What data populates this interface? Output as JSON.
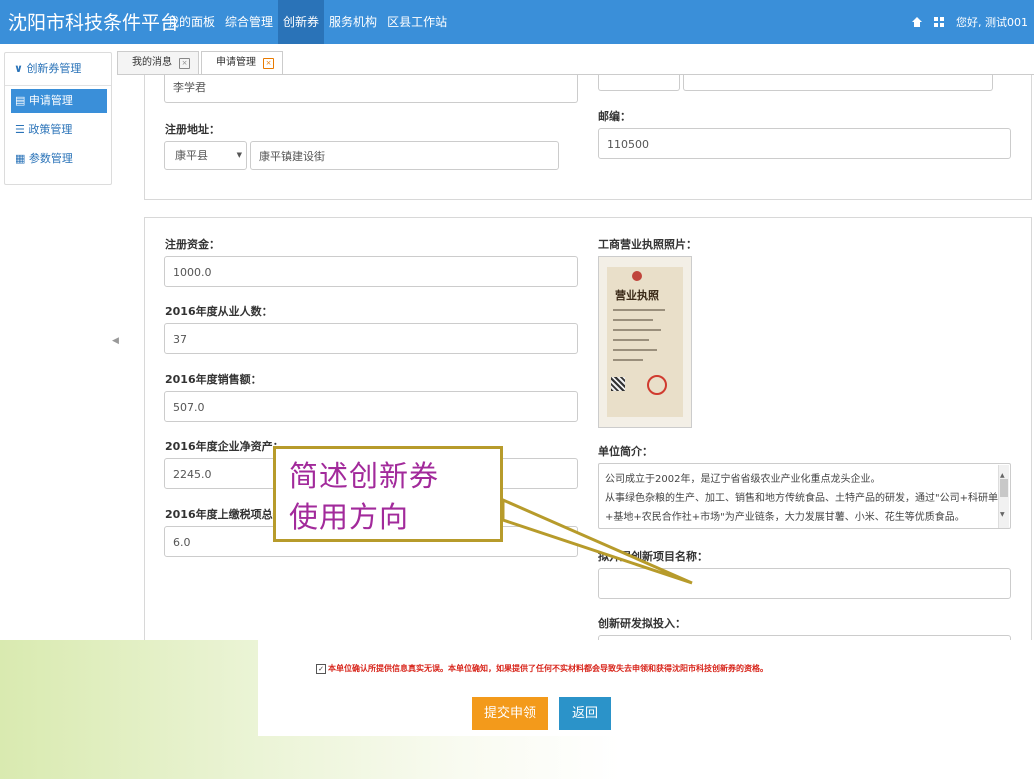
{
  "header": {
    "brand": "沈阳市科技条件平台",
    "nav": [
      "我的面板",
      "综合管理",
      "创新券",
      "服务机构",
      "区县工作站"
    ],
    "active_nav": "创新券",
    "greeting": "您好, 测试001"
  },
  "sidebar": {
    "section": "创新券管理",
    "items": [
      {
        "label": "申请管理",
        "icon": "doc-icon",
        "active": true
      },
      {
        "label": "政策管理",
        "icon": "list-icon",
        "active": false
      },
      {
        "label": "参数管理",
        "icon": "grid-icon",
        "active": false
      }
    ]
  },
  "tabs": [
    {
      "label": "我的消息",
      "active": false
    },
    {
      "label": "申请管理",
      "active": true
    }
  ],
  "panel1": {
    "legal_person_value": "李学君",
    "reg_address_label": "注册地址：",
    "county_value": "康平县",
    "street_value": "康平镇建设街",
    "postcode_label": "邮编：",
    "postcode_value": "110500"
  },
  "panel2": {
    "reg_capital_label": "注册资金：",
    "reg_capital_value": "1000.0",
    "employees_label": "2016年度从业人数：",
    "employees_value": "37",
    "sales_label": "2016年度销售额：",
    "sales_value": "507.0",
    "net_assets_label": "2016年度企业净资产：",
    "net_assets_value": "2245.0",
    "tax_label": "2016年度上缴税项总额：",
    "tax_value": "6.0",
    "license_label": "工商营业执照照片：",
    "license_photo_title": "营业执照",
    "intro_label": "单位简介：",
    "intro_lines": [
      "公司成立于2002年，是辽宁省省级农业产业化重点龙头企业。",
      "从事绿色杂粮的生产、加工、销售和地方传统食品、土特产品的研发，通过\"公司+科研单位",
      "+基地+农民合作社+市场\"为产业链条，大力发展甘薯、小米、花生等优质食品。"
    ],
    "project_label": "拟开展创新项目名称：",
    "rd_label": "创新研发拟投入："
  },
  "annotation": {
    "lines": [
      "简述创新券",
      "使用方向"
    ],
    "border_color": "#b79b2b",
    "text_color": "#a22a9b"
  },
  "footer": {
    "agree_text": "本单位确认所提供信息真实无误。本单位确知，如果提供了任何不实材料都会导致失去申领和获得沈阳市科技创新券的资格。",
    "submit_label": "提交申领",
    "back_label": "返回"
  },
  "colors": {
    "header_bg": "#3a8fd9",
    "nav_active_bg": "#2a73b8",
    "submit_bg": "#f39a1b",
    "back_bg": "#2b93c9",
    "agree_text": "#d8261c"
  }
}
